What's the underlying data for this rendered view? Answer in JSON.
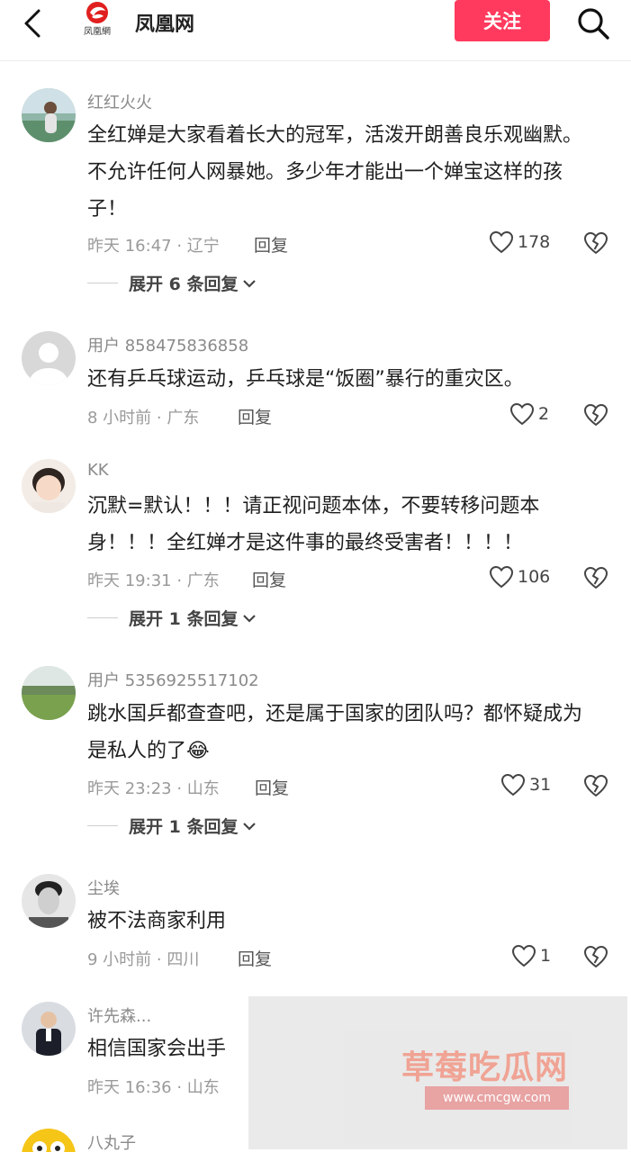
{
  "header": {
    "logo_text": "凤凰網",
    "channel": "凤凰网",
    "follow": "关注"
  },
  "comments": [
    {
      "user": "红红火火",
      "text": "全红婵是大家看着长大的冠军，活泼开朗善良乐观幽默。不允许任何人网暴她。多少年才能出一个婵宝这样的孩子！",
      "meta": "昨天 16:47 · 辽宁",
      "reply": "回复",
      "likes": "178",
      "expand": "展开 6 条回复"
    },
    {
      "user": "用户 858475836858",
      "text": "还有乒乓球运动，乒乓球是“饭圈”暴行的重灾区。",
      "meta": "8 小时前 · 广东",
      "reply": "回复",
      "likes": "2"
    },
    {
      "user": "KK",
      "text": "沉默=默认！！！请正视问题本体，不要转移问题本身！！！全红婵才是这件事的最终受害者！！！！",
      "meta": "昨天 19:31 · 广东",
      "reply": "回复",
      "likes": "106",
      "expand": "展开 1 条回复"
    },
    {
      "user": "用户 5356925517102",
      "text": "跳水国乒都查查吧，还是属于国家的团队吗？都怀疑成为是私人的了",
      "emoji": "😂",
      "meta": "昨天 23:23 · 山东",
      "reply": "回复",
      "likes": "31",
      "expand": "展开 1 条回复"
    },
    {
      "user": "尘埃",
      "text": "被不法商家利用",
      "meta": "9 小时前 · 四川",
      "reply": "回复",
      "likes": "1"
    },
    {
      "user": "许先森...",
      "text": "相信国家会出手",
      "meta": "昨天 16:36 · 山东"
    },
    {
      "user": "八丸子"
    }
  ],
  "watermark": {
    "title": "草莓吃瓜网",
    "url": "www.cmcgw.com"
  },
  "colors": {
    "accent": "#ff3a5e"
  }
}
